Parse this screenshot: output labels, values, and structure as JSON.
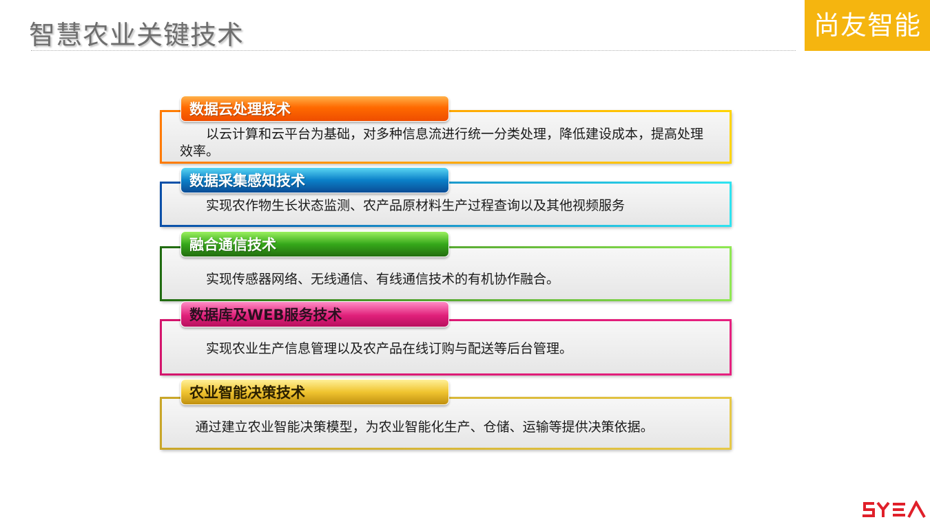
{
  "header": {
    "title": "智慧农业关键技术",
    "brand": "尚友智能"
  },
  "sections": [
    {
      "heading": "数据云处理技术",
      "text": "以云计算和云平台为基础，对多种信息流进行统一分类处理，降低建设成本，提高处理效率。",
      "color": "#ff6a00"
    },
    {
      "heading": "数据采集感知技术",
      "text": "实现农作物生长状态监测、农产品原材料生产过程查询以及其他视频服务",
      "color": "#0b80c8"
    },
    {
      "heading": "融合通信技术",
      "text": "实现传感器网络、无线通信、有线通信技术的有机协作融合。",
      "color": "#36a81a"
    },
    {
      "heading": "数据库及WEB服务技术",
      "text": "实现农业生产信息管理以及农产品在线订购与配送等后台管理。",
      "color": "#e0207a"
    },
    {
      "heading": "农业智能决策技术",
      "text": "通过建立农业智能决策模型，为农业智能化生产、仓储、运输等提供决策依据。",
      "color": "#f0c430"
    }
  ],
  "footer": {
    "logo": "SYEA",
    "logo_color": "#e0202a"
  }
}
